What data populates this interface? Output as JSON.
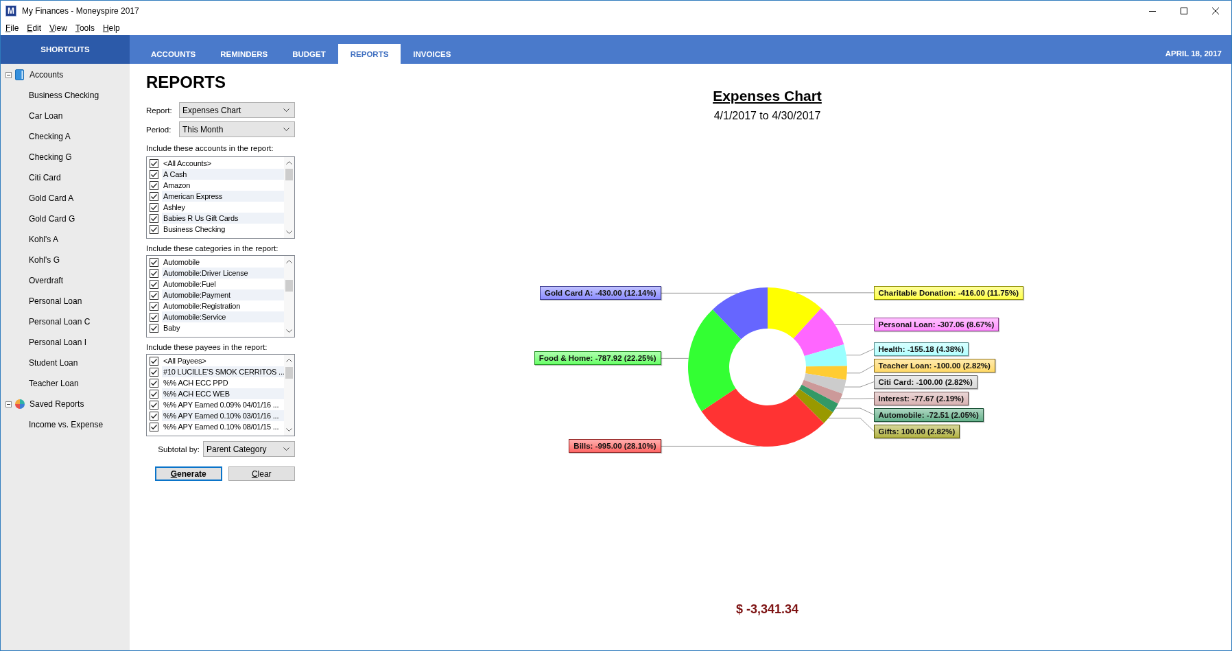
{
  "window": {
    "logo": "M",
    "title": "My Finances - Moneyspire 2017"
  },
  "menu": [
    "File",
    "Edit",
    "View",
    "Tools",
    "Help"
  ],
  "sidebar": {
    "header": "SHORTCUTS",
    "items": [
      {
        "label": "Accounts",
        "kind": "accounts",
        "expanded": true,
        "selected": false,
        "children": [
          {
            "label": "Business Checking",
            "selected": false
          },
          {
            "label": "Car Loan",
            "selected": false
          },
          {
            "label": "Checking A",
            "selected": false
          },
          {
            "label": "Checking G",
            "selected": false
          },
          {
            "label": "Citi Card",
            "selected": false
          },
          {
            "label": "Gold Card A",
            "selected": false
          },
          {
            "label": "Gold Card G",
            "selected": false
          },
          {
            "label": "Kohl's A",
            "selected": false
          },
          {
            "label": "Kohl's G",
            "selected": false
          },
          {
            "label": "Overdraft",
            "selected": false
          },
          {
            "label": "Personal Loan",
            "selected": false
          },
          {
            "label": "Personal Loan C",
            "selected": false
          },
          {
            "label": "Personal Loan I",
            "selected": false
          },
          {
            "label": "Student Loan",
            "selected": false
          },
          {
            "label": "Teacher Loan",
            "selected": false
          }
        ]
      },
      {
        "label": "Saved Reports",
        "kind": "reports",
        "expanded": true,
        "selected": false,
        "children": [
          {
            "label": "Income vs. Expense",
            "selected": false
          }
        ]
      }
    ]
  },
  "tabs": [
    {
      "label": "ACCOUNTS",
      "selected": false
    },
    {
      "label": "REMINDERS",
      "selected": false
    },
    {
      "label": "BUDGET",
      "selected": false
    },
    {
      "label": "REPORTS",
      "selected": true
    },
    {
      "label": "INVOICES",
      "selected": false
    }
  ],
  "date": "APRIL 18, 2017",
  "report_options": {
    "heading": "REPORTS",
    "fields": [
      {
        "label": "Report:",
        "value": "Expenses Chart"
      },
      {
        "label": "Period:",
        "value": "This Month"
      }
    ],
    "lists": [
      {
        "label": "Include these accounts in the report:",
        "items": [
          {
            "label": "<All Accounts>",
            "checked": true
          },
          {
            "label": "A Cash",
            "checked": true
          },
          {
            "label": "Amazon",
            "checked": true
          },
          {
            "label": "American Express",
            "checked": true
          },
          {
            "label": "Ashley",
            "checked": true
          },
          {
            "label": "Babies R Us Gift Cards",
            "checked": true
          },
          {
            "label": "Business Checking",
            "checked": true
          }
        ]
      },
      {
        "label": "Include these categories in the report:",
        "items": [
          {
            "label": "Automobile",
            "checked": true
          },
          {
            "label": "Automobile:Driver License",
            "checked": true
          },
          {
            "label": "Automobile:Fuel",
            "checked": true
          },
          {
            "label": "Automobile:Payment",
            "checked": true
          },
          {
            "label": "Automobile:Registration",
            "checked": true
          },
          {
            "label": "Automobile:Service",
            "checked": true
          },
          {
            "label": "Baby",
            "checked": true
          }
        ]
      },
      {
        "label": "Include these payees in the report:",
        "items": [
          {
            "label": "<All Payees>",
            "checked": true
          },
          {
            "label": "#10 LUCILLE'S SMOK CERRITOS ...",
            "checked": true
          },
          {
            "label": "%% ACH ECC PPD",
            "checked": true
          },
          {
            "label": "%% ACH ECC WEB",
            "checked": true
          },
          {
            "label": "%% APY Earned 0.09% 04/01/16 ...",
            "checked": true
          },
          {
            "label": "%% APY Earned 0.10% 03/01/16 ...",
            "checked": true
          },
          {
            "label": "%% APY Earned 0.10% 08/01/15 ...",
            "checked": true
          }
        ]
      }
    ],
    "subtotal": {
      "label": "Subtotal by:",
      "value": "Parent Category"
    },
    "buttons": [
      {
        "label": "Generate",
        "focused": true
      },
      {
        "label": "Clear",
        "focused": false
      }
    ]
  },
  "report": {
    "subtitle": "4/1/2017 to 4/30/2017",
    "chart_data": {
      "type": "donut",
      "title": "Expenses Chart",
      "categories": [
        "Charitable Donation: -416.00 (11.75%)",
        "Personal Loan: -307.06 (8.67%)",
        "Health: -155.18 (4.38%)",
        "Teacher Loan: -100.00 (2.82%)",
        "Citi Card: -100.00 (2.82%)",
        "Interest: -77.67 (2.19%)",
        "Automobile: -72.51 (2.05%)",
        "Gifts: 100.00 (2.82%)",
        "Bills: -995.00 (28.10%)",
        "Food & Home: -787.92 (22.25%)",
        "Gold Card A: -430.00 (12.14%)"
      ],
      "values": [
        11.75,
        8.67,
        4.38,
        2.82,
        2.82,
        2.19,
        2.05,
        2.82,
        28.1,
        22.25,
        12.14
      ],
      "colors": [
        "#ffff00",
        "#ff66ff",
        "#99ffff",
        "#ffcc33",
        "#cccccc",
        "#cc9999",
        "#339966",
        "#999900",
        "#ff3333",
        "#33ff33",
        "#6666ff"
      ]
    },
    "total": "$ -3,341.34"
  }
}
